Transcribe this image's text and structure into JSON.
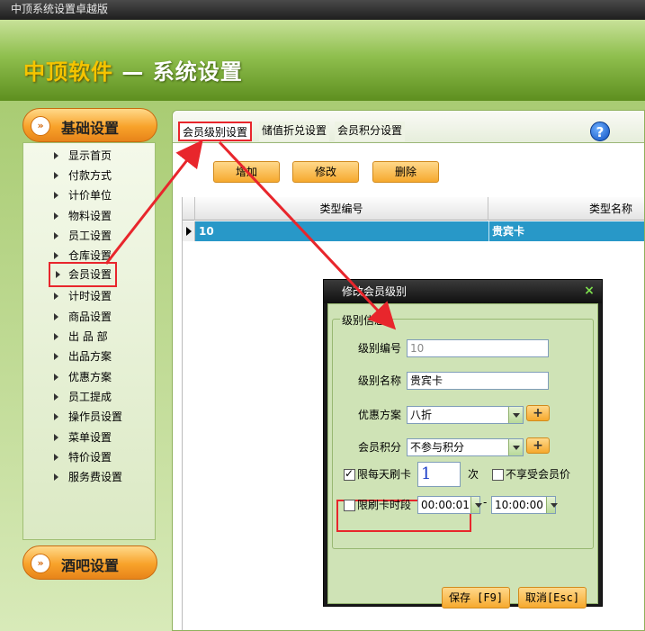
{
  "window": {
    "title": "中顶系统设置卓越版"
  },
  "banner": {
    "brand": "中顶软件",
    "title": " — 系统设置"
  },
  "sidebar": {
    "category_basic": "基础设置",
    "category_bar": "酒吧设置",
    "items": [
      {
        "label": "显示首页"
      },
      {
        "label": "付款方式"
      },
      {
        "label": "计价单位"
      },
      {
        "label": "物料设置"
      },
      {
        "label": "员工设置"
      },
      {
        "label": "仓库设置"
      },
      {
        "label": "会员设置"
      },
      {
        "label": "计时设置"
      },
      {
        "label": "商品设置"
      },
      {
        "label": "出 品 部"
      },
      {
        "label": "出品方案"
      },
      {
        "label": "优惠方案"
      },
      {
        "label": "员工提成"
      },
      {
        "label": "操作员设置"
      },
      {
        "label": "菜单设置"
      },
      {
        "label": "特价设置"
      },
      {
        "label": "服务费设置"
      }
    ]
  },
  "tabs": [
    {
      "label": "会员级别设置"
    },
    {
      "label": "储值折兑设置"
    },
    {
      "label": "会员积分设置"
    }
  ],
  "help": {
    "glyph": "?"
  },
  "toolbar": {
    "add": "增加",
    "edit": "修改",
    "delete": "删除"
  },
  "grid": {
    "indicator_header": "",
    "columns": [
      "类型编号",
      "类型名称"
    ],
    "rows": [
      {
        "code": "10",
        "name": "贵宾卡"
      }
    ]
  },
  "dialog": {
    "title": "修改会员级别",
    "close": "×",
    "group_title": "级别信息",
    "level_code_label": "级别编号",
    "level_code_value": "10",
    "level_name_label": "级别名称",
    "level_name_value": "贵宾卡",
    "discount_label": "优惠方案",
    "discount_value": "八折",
    "points_label": "会员积分",
    "points_value": "不参与积分",
    "plus": "+",
    "daily_limit_label": "限每天刷卡",
    "daily_limit_value": "1",
    "daily_limit_unit": "次",
    "no_member_price_label": "不享受会员价",
    "time_limit_label": "限刷卡时段",
    "time_start": "00:00:01",
    "time_sep": "-",
    "time_end": "10:00:00",
    "save": "保存 [F9]",
    "cancel": "取消[Esc]"
  },
  "colors": {
    "highlight": "#e8262c",
    "selected_row": "#2898c8",
    "accent_orange": "#f6a92e"
  }
}
